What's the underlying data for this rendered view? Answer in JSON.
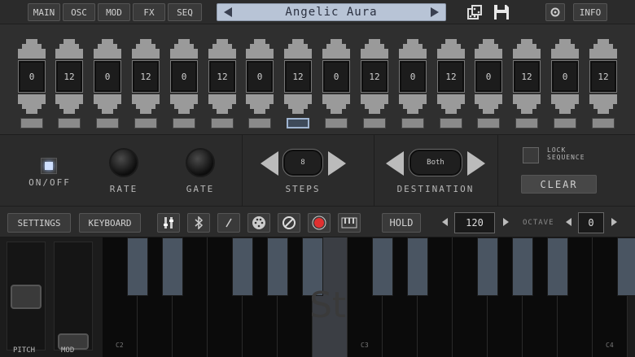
{
  "nav": {
    "tabs": [
      {
        "label": "MAIN",
        "active": true
      },
      {
        "label": "OSC",
        "active": false
      },
      {
        "label": "MOD",
        "active": false
      },
      {
        "label": "FX",
        "active": false
      },
      {
        "label": "SEQ",
        "active": true
      }
    ],
    "preset_name": "Angelic Aura",
    "info_label": "INFO"
  },
  "sequencer": {
    "steps": [
      "0",
      "12",
      "0",
      "12",
      "0",
      "12",
      "0",
      "12",
      "0",
      "12",
      "0",
      "12",
      "0",
      "12",
      "0",
      "12"
    ],
    "active_led": 7
  },
  "controls": {
    "onoff_label": "ON/OFF",
    "rate_label": "RATE",
    "gate_label": "GATE",
    "steps_label": "STEPS",
    "steps_value": "8",
    "destination_label": "DESTINATION",
    "destination_value": "Both",
    "lock_label_1": "LOCK",
    "lock_label_2": "SEQUENCE",
    "clear_label": "CLEAR"
  },
  "toolbar": {
    "settings_label": "SETTINGS",
    "keyboard_label": "KEYBOARD",
    "hold_label": "HOLD",
    "bpm_value": "120",
    "octave_label": "OCTAVE",
    "octave_value": "0",
    "record_color": "#e03030"
  },
  "keyboard": {
    "pitch_label": "PITCH",
    "mod_label": "MOD",
    "key_labels": [
      "C2",
      "C3",
      "C4"
    ],
    "watermark": "St"
  },
  "colors": {
    "preset_bg": "#b8c4d6",
    "black_key": "#4a5562",
    "active_step": "#9fb4d0"
  }
}
